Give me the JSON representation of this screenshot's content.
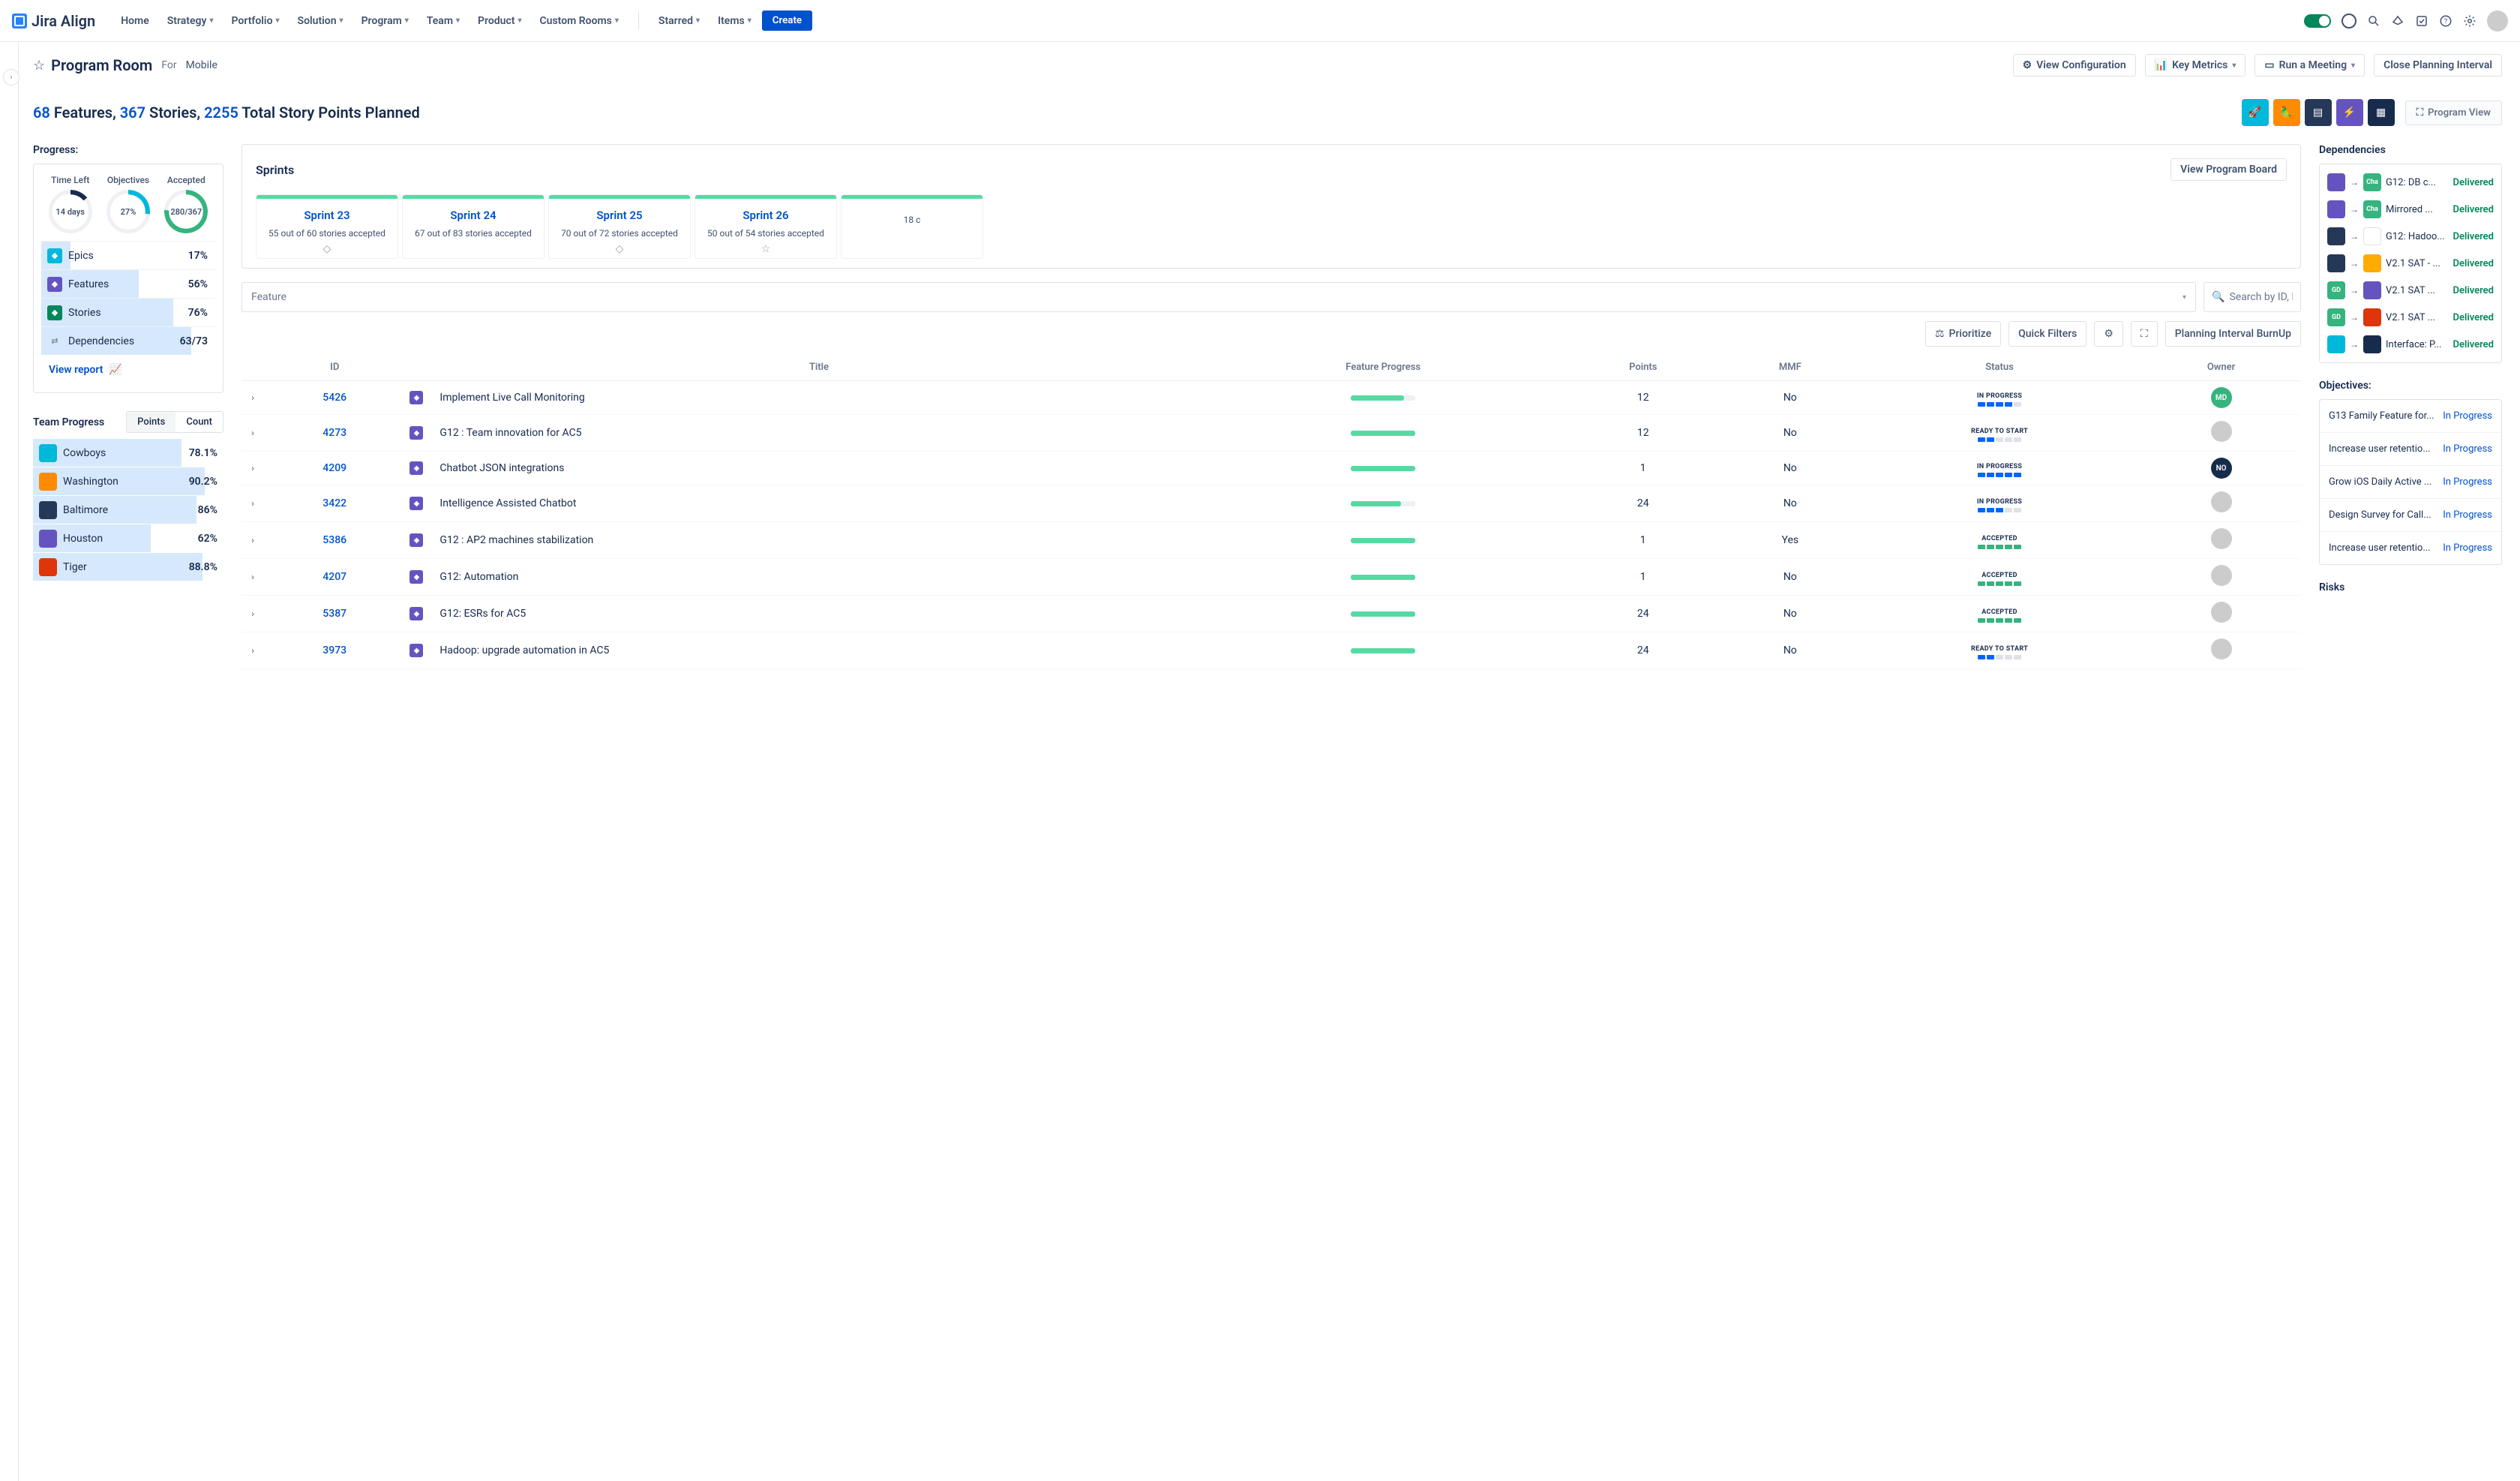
{
  "nav": {
    "brand": "Jira Align",
    "items": [
      "Home",
      "Strategy",
      "Portfolio",
      "Solution",
      "Program",
      "Team",
      "Product",
      "Custom Rooms"
    ],
    "starred": "Starred",
    "items2": "Items",
    "create": "Create"
  },
  "header": {
    "title": "Program Room",
    "for_label": "For",
    "for_value": "Mobile",
    "view_config": "View Configuration",
    "key_metrics": "Key Metrics",
    "run_meeting": "Run a Meeting",
    "close_pi": "Close Planning Interval"
  },
  "summary": {
    "features_n": "68",
    "features_l": " Features, ",
    "stories_n": "367",
    "stories_l": " Stories, ",
    "points_n": "2255",
    "points_l": " Total Story Points Planned",
    "program_view": "Program View"
  },
  "progress": {
    "label": "Progress:",
    "dials": {
      "time_left_h": "Time Left",
      "time_left_v": "14 days",
      "objectives_h": "Objectives",
      "objectives_v": "27%",
      "accepted_h": "Accepted",
      "accepted_v": "280/367"
    },
    "rows": [
      {
        "ic": "t-blue",
        "label": "Epics",
        "value": "17%",
        "bar": 17
      },
      {
        "ic": "t-purple",
        "label": "Features",
        "value": "56%",
        "bar": 56
      },
      {
        "ic": "t-green",
        "label": "Stories",
        "value": "76%",
        "bar": 76
      },
      {
        "ic": "",
        "label": "Dependencies",
        "value": "63/73",
        "bar": 86
      }
    ],
    "view_report": "View report"
  },
  "team_progress": {
    "label": "Team Progress",
    "tab_points": "Points",
    "tab_count": "Count",
    "rows": [
      {
        "c": "#00B8D9",
        "label": "Cowboys",
        "value": "78.1%",
        "bar": 78
      },
      {
        "c": "#FF8B00",
        "label": "Washington",
        "value": "90.2%",
        "bar": 90
      },
      {
        "c": "#253858",
        "label": "Baltimore",
        "value": "86%",
        "bar": 86
      },
      {
        "c": "#6554C0",
        "label": "Houston",
        "value": "62%",
        "bar": 62
      },
      {
        "c": "#DE350B",
        "label": "Tiger",
        "value": "88.8%",
        "bar": 89
      }
    ]
  },
  "sprints": {
    "label": "Sprints",
    "view_board": "View Program Board",
    "items": [
      {
        "name": "Sprint 23",
        "sub": "55 out of 60 stories accepted",
        "icon": "◇"
      },
      {
        "name": "Sprint 24",
        "sub": "67 out of 83 stories accepted",
        "icon": ""
      },
      {
        "name": "Sprint 25",
        "sub": "70 out of 72 stories accepted",
        "icon": "◇"
      },
      {
        "name": "Sprint 26",
        "sub": "50 out of 54 stories accepted",
        "icon": "☆"
      },
      {
        "name": "",
        "sub": "18 c",
        "icon": ""
      }
    ],
    "feature_sel": "Feature",
    "search_ph": "Search by ID, Nar",
    "prioritize": "Prioritize",
    "quick_filters": "Quick Filters",
    "burnup": "Planning Interval BurnUp"
  },
  "table": {
    "cols": {
      "id": "ID",
      "title": "Title",
      "fp": "Feature Progress",
      "points": "Points",
      "mmf": "MMF",
      "status": "Status",
      "owner": "Owner"
    },
    "rows": [
      {
        "id": "5426",
        "title": "Implement Live Call Monitoring",
        "fp": 82,
        "points": "12",
        "mmf": "No",
        "status": "IN PROGRESS",
        "blocks": "bbbbe",
        "owner": "MD",
        "ownC": "#36B37E"
      },
      {
        "id": "4273",
        "title": "G12 : Team innovation for AC5",
        "fp": 100,
        "points": "12",
        "mmf": "No",
        "status": "READY TO START",
        "blocks": "bbeee",
        "owner": "",
        "ownC": "#ccc"
      },
      {
        "id": "4209",
        "title": "Chatbot JSON integrations",
        "fp": 100,
        "points": "1",
        "mmf": "No",
        "status": "IN PROGRESS",
        "blocks": "bbbbb",
        "owner": "NO",
        "ownC": "#172B4D"
      },
      {
        "id": "3422",
        "title": "Intelligence Assisted Chatbot",
        "fp": 78,
        "points": "24",
        "mmf": "No",
        "status": "IN PROGRESS",
        "blocks": "bbbee",
        "owner": "",
        "ownC": "#ccc"
      },
      {
        "id": "5386",
        "title": "G12 : AP2 machines stabilization",
        "fp": 100,
        "points": "1",
        "mmf": "Yes",
        "status": "ACCEPTED",
        "blocks": "ggggg",
        "owner": "",
        "ownC": "#ccc"
      },
      {
        "id": "4207",
        "title": "G12: Automation",
        "fp": 100,
        "points": "1",
        "mmf": "No",
        "status": "ACCEPTED",
        "blocks": "ggggg",
        "owner": "",
        "ownC": "#ccc"
      },
      {
        "id": "5387",
        "title": "G12: ESRs for AC5",
        "fp": 100,
        "points": "24",
        "mmf": "No",
        "status": "ACCEPTED",
        "blocks": "ggggg",
        "owner": "",
        "ownC": "#ccc"
      },
      {
        "id": "3973",
        "title": "Hadoop: upgrade automation in AC5",
        "fp": 100,
        "points": "24",
        "mmf": "No",
        "status": "READY TO START",
        "blocks": "bbeee",
        "owner": "",
        "ownC": "#ccc"
      }
    ]
  },
  "deps": {
    "label": "Dependencies",
    "rows": [
      {
        "a": "#6554C0",
        "b": "#36B37E",
        "bt": "Cha",
        "label": "G12: DB c...",
        "status": "Delivered"
      },
      {
        "a": "#6554C0",
        "b": "#36B37E",
        "bt": "Cha",
        "label": "Mirrored ...",
        "status": "Delivered"
      },
      {
        "a": "#253858",
        "b": "#fff",
        "bb": "1px solid #dfe1e6",
        "label": "G12: Hadoo...",
        "status": "Delivered"
      },
      {
        "a": "#253858",
        "b": "#FFAB00",
        "label": "V2.1 SAT - ...",
        "status": "Delivered"
      },
      {
        "a": "#36B37E",
        "at": "GD",
        "b": "#6554C0",
        "label": "V2.1 SAT ...",
        "status": "Delivered"
      },
      {
        "a": "#36B37E",
        "at": "GD",
        "b": "#DE350B",
        "label": "V2.1 SAT ...",
        "status": "Delivered"
      },
      {
        "a": "#00B8D9",
        "b": "#172B4D",
        "label": "Interface: P...",
        "status": "Delivered"
      }
    ]
  },
  "objectives": {
    "label": "Objectives:",
    "rows": [
      {
        "label": "G13 Family Feature for...",
        "status": "In Progress"
      },
      {
        "label": "Increase user retentio...",
        "status": "In Progress"
      },
      {
        "label": "Grow iOS Daily Active ...",
        "status": "In Progress"
      },
      {
        "label": "Design Survey for Call...",
        "status": "In Progress"
      },
      {
        "label": "Increase user retentio...",
        "status": "In Progress"
      }
    ]
  },
  "risks_label": "Risks"
}
